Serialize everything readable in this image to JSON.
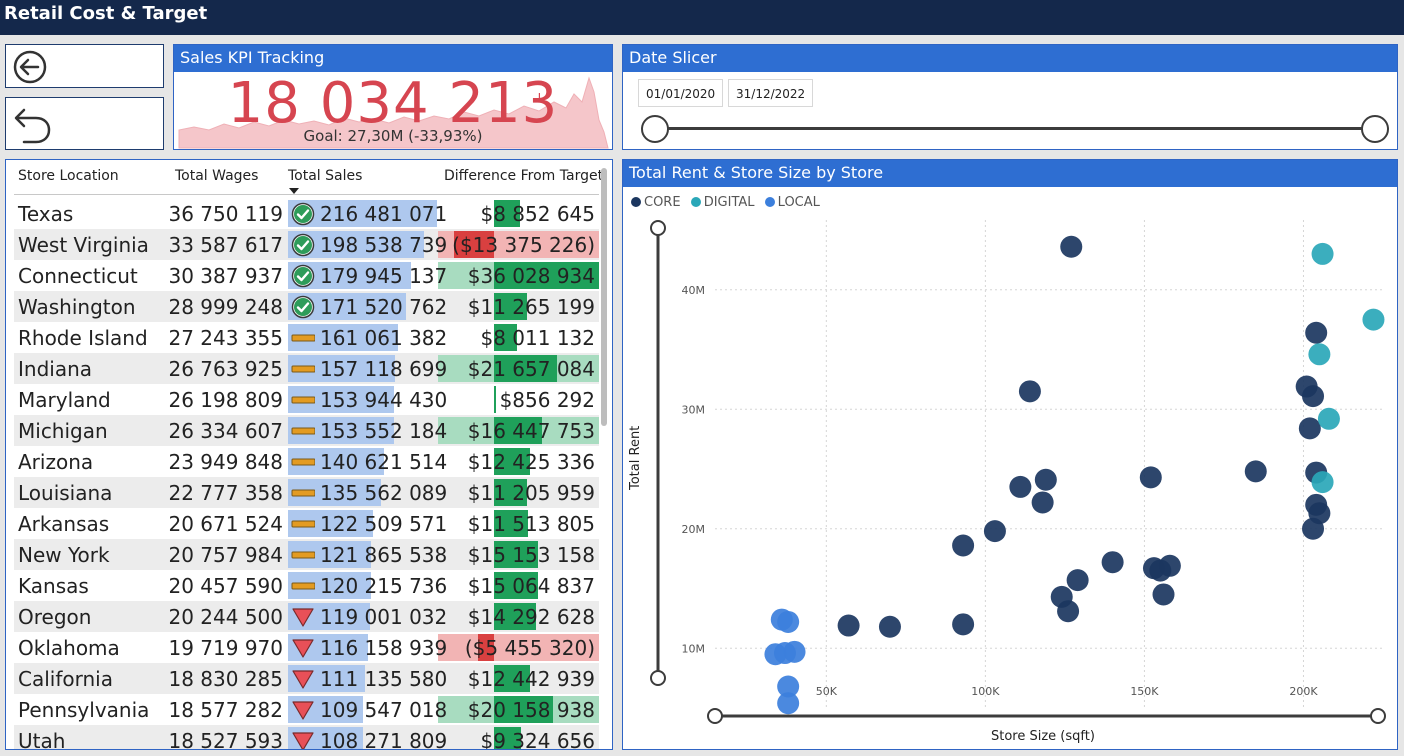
{
  "header": {
    "title": "Retail Cost & Target"
  },
  "nav": {
    "back_icon": "arrow-left-circle-icon",
    "undo_icon": "undo-arrow-icon"
  },
  "kpi": {
    "title": "Sales KPI Tracking",
    "value": "18 034 213",
    "status_mark": "!",
    "goal": "Goal: 27,30M (-33,93%)",
    "color": "#d64550",
    "trend_color": "#f5c6ca"
  },
  "date_slicer": {
    "title": "Date Slicer",
    "start": "01/01/2020",
    "end": "31/12/2022"
  },
  "table": {
    "columns": [
      "Store Location",
      "Total Wages",
      "Total Sales",
      "Difference From Target"
    ],
    "sort_column": "Total Sales",
    "colors": {
      "sales_bar": "#aec8ee",
      "pos_bar": "#1fa05a",
      "pos_light": "#a8dcc0",
      "neg_bar": "#d94040",
      "neg_light": "#f2b4b4"
    },
    "rows": [
      {
        "location": "Texas",
        "wages": "36 750 119",
        "sales": "216 481 071",
        "sales_pct": 0.93,
        "status": "check",
        "diff": "$8 852 645",
        "diff_value": 8852645
      },
      {
        "location": "West Virginia",
        "wages": "33 587 617",
        "sales": "198 538 739",
        "sales_pct": 0.85,
        "status": "check",
        "diff": "($13 375 226)",
        "diff_value": -13375226
      },
      {
        "location": "Connecticut",
        "wages": "30 387 937",
        "sales": "179 945 137",
        "sales_pct": 0.77,
        "status": "check",
        "diff": "$36 028 934",
        "diff_value": 36028934
      },
      {
        "location": "Washington",
        "wages": "28 999 248",
        "sales": "171 520 762",
        "sales_pct": 0.74,
        "status": "check",
        "diff": "$11 265 199",
        "diff_value": 11265199
      },
      {
        "location": "Rhode Island",
        "wages": "27 243 355",
        "sales": "161 061 382",
        "sales_pct": 0.69,
        "status": "neutral",
        "diff": "$8 011 132",
        "diff_value": 8011132
      },
      {
        "location": "Indiana",
        "wages": "26 763 925",
        "sales": "157 118 699",
        "sales_pct": 0.67,
        "status": "neutral",
        "diff": "$21 657 084",
        "diff_value": 21657084
      },
      {
        "location": "Maryland",
        "wages": "26 198 809",
        "sales": "153 944 430",
        "sales_pct": 0.66,
        "status": "neutral",
        "diff": "$856 292",
        "diff_value": 856292
      },
      {
        "location": "Michigan",
        "wages": "26 334 607",
        "sales": "153 552 184",
        "sales_pct": 0.66,
        "status": "neutral",
        "diff": "$16 447 753",
        "diff_value": 16447753
      },
      {
        "location": "Arizona",
        "wages": "23 949 848",
        "sales": "140 621 514",
        "sales_pct": 0.6,
        "status": "neutral",
        "diff": "$12 425 336",
        "diff_value": 12425336
      },
      {
        "location": "Louisiana",
        "wages": "22 777 358",
        "sales": "135 562 089",
        "sales_pct": 0.58,
        "status": "neutral",
        "diff": "$11 205 959",
        "diff_value": 11205959
      },
      {
        "location": "Arkansas",
        "wages": "20 671 524",
        "sales": "122 509 571",
        "sales_pct": 0.53,
        "status": "neutral",
        "diff": "$11 513 805",
        "diff_value": 11513805
      },
      {
        "location": "New York",
        "wages": "20 757 984",
        "sales": "121 865 538",
        "sales_pct": 0.52,
        "status": "neutral",
        "diff": "$15 153 158",
        "diff_value": 15153158
      },
      {
        "location": "Kansas",
        "wages": "20 457 590",
        "sales": "120 215 736",
        "sales_pct": 0.52,
        "status": "neutral",
        "diff": "$15 064 837",
        "diff_value": 15064837
      },
      {
        "location": "Oregon",
        "wages": "20 244 500",
        "sales": "119 001 032",
        "sales_pct": 0.51,
        "status": "down",
        "diff": "$14 292 628",
        "diff_value": 14292628
      },
      {
        "location": "Oklahoma",
        "wages": "19 719 970",
        "sales": "116 158 939",
        "sales_pct": 0.5,
        "status": "down",
        "diff": "($5 455 320)",
        "diff_value": -5455320
      },
      {
        "location": "California",
        "wages": "18 830 285",
        "sales": "111 135 580",
        "sales_pct": 0.48,
        "status": "down",
        "diff": "$12 442 939",
        "diff_value": 12442939
      },
      {
        "location": "Pennsylvania",
        "wages": "18 577 282",
        "sales": "109 547 018",
        "sales_pct": 0.47,
        "status": "down",
        "diff": "$20 158 938",
        "diff_value": 20158938
      },
      {
        "location": "Utah",
        "wages": "18 527 593",
        "sales": "108 271 809",
        "sales_pct": 0.47,
        "status": "down",
        "diff": "$9 324 656",
        "diff_value": 9324656
      }
    ]
  },
  "chart_data": {
    "type": "scatter",
    "title": "Total Rent & Store Size by Store",
    "xlabel": "Store Size (sqft)",
    "ylabel": "Total Rent",
    "x_ticks": [
      "50K",
      "100K",
      "150K",
      "200K"
    ],
    "y_ticks": [
      "10M",
      "20M",
      "30M",
      "40M"
    ],
    "xlim": [
      15000,
      225000
    ],
    "ylim": [
      5000000,
      45000000
    ],
    "grid": true,
    "legend_position": "top-left",
    "series": [
      {
        "name": "CORE",
        "color": "#1b365f",
        "points": [
          [
            127000,
            43600000
          ],
          [
            114000,
            31500000
          ],
          [
            111000,
            23500000
          ],
          [
            119000,
            24100000
          ],
          [
            118000,
            22200000
          ],
          [
            93000,
            18600000
          ],
          [
            103000,
            19800000
          ],
          [
            140000,
            17200000
          ],
          [
            129000,
            15700000
          ],
          [
            124000,
            14300000
          ],
          [
            126000,
            13100000
          ],
          [
            152000,
            24300000
          ],
          [
            153000,
            16700000
          ],
          [
            155000,
            16500000
          ],
          [
            158000,
            16900000
          ],
          [
            156000,
            14500000
          ],
          [
            185000,
            24800000
          ],
          [
            57000,
            11900000
          ],
          [
            70000,
            11800000
          ],
          [
            93000,
            12000000
          ],
          [
            204000,
            36400000
          ],
          [
            201000,
            31900000
          ],
          [
            203000,
            31100000
          ],
          [
            202000,
            28400000
          ],
          [
            204000,
            24700000
          ],
          [
            204000,
            22000000
          ],
          [
            205000,
            21300000
          ],
          [
            203000,
            20000000
          ]
        ]
      },
      {
        "name": "DIGITAL",
        "color": "#2aa7b8",
        "points": [
          [
            206000,
            43000000
          ],
          [
            222000,
            37500000
          ],
          [
            205000,
            34600000
          ],
          [
            208000,
            29200000
          ],
          [
            206000,
            23900000
          ]
        ]
      },
      {
        "name": "LOCAL",
        "color": "#3c7fdc",
        "points": [
          [
            36000,
            12400000
          ],
          [
            38000,
            12200000
          ],
          [
            34000,
            9500000
          ],
          [
            37000,
            9600000
          ],
          [
            40000,
            9700000
          ],
          [
            38000,
            6800000
          ],
          [
            38000,
            5400000
          ]
        ]
      }
    ]
  }
}
